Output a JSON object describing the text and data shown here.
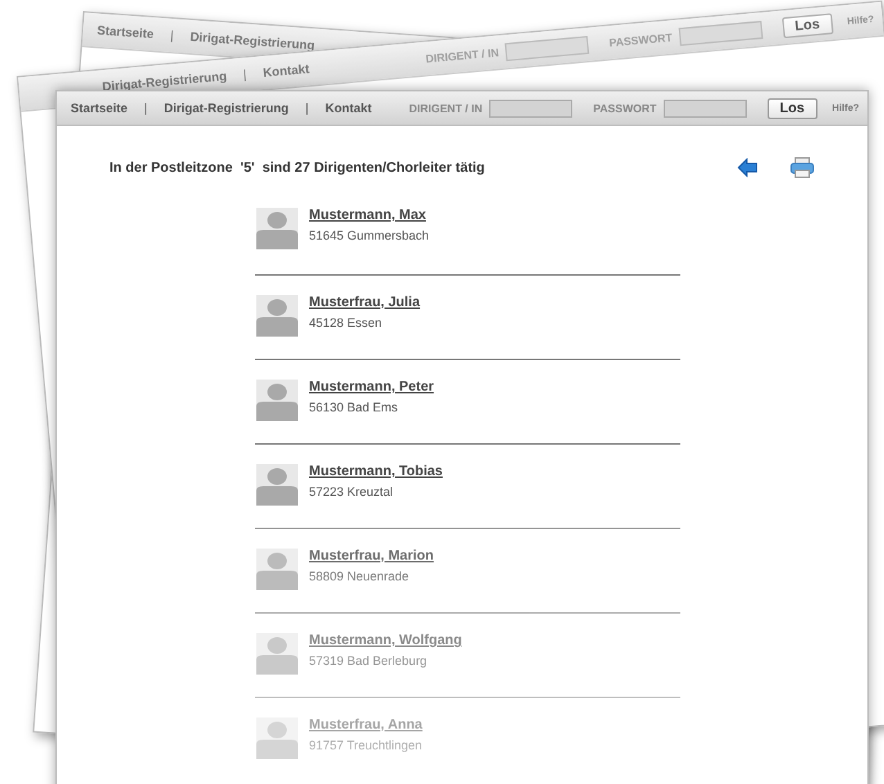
{
  "background_pages": [
    {
      "nav_links": [
        "Startseite",
        "Dirigat-Registrierung"
      ]
    },
    {
      "nav_links": [
        "Dirigat-Registrierung",
        "Kontakt"
      ],
      "login": {
        "user_label": "DIRIGENT / IN",
        "password_label": "PASSWORT",
        "submit": "Los",
        "help": "Hilfe?"
      }
    }
  ],
  "header": {
    "nav_links": [
      "Startseite",
      "Dirigat-Registrierung",
      "Kontakt"
    ],
    "separator": "|",
    "login": {
      "user_label": "DIRIGENT / IN",
      "password_label": "PASSWORT",
      "submit": "Los",
      "help": "Hilfe?"
    }
  },
  "heading": "In der Postleitzone  '5'  sind 27 Dirigenten/Chorleiter tätig",
  "conductors": [
    {
      "name": "Mustermann, Max",
      "location": "51645 Gummersbach"
    },
    {
      "name": "Musterfrau, Julia",
      "location": "45128 Essen"
    },
    {
      "name": "Mustermann, Peter",
      "location": "56130 Bad Ems"
    },
    {
      "name": "Mustermann, Tobias",
      "location": "57223 Kreuztal"
    },
    {
      "name": "Musterfrau, Marion",
      "location": "58809 Neuenrade"
    },
    {
      "name": "Mustermann, Wolfgang",
      "location": "57319 Bad Berleburg"
    },
    {
      "name": "Musterfrau, Anna",
      "location": "91757 Treuchtlingen"
    }
  ]
}
